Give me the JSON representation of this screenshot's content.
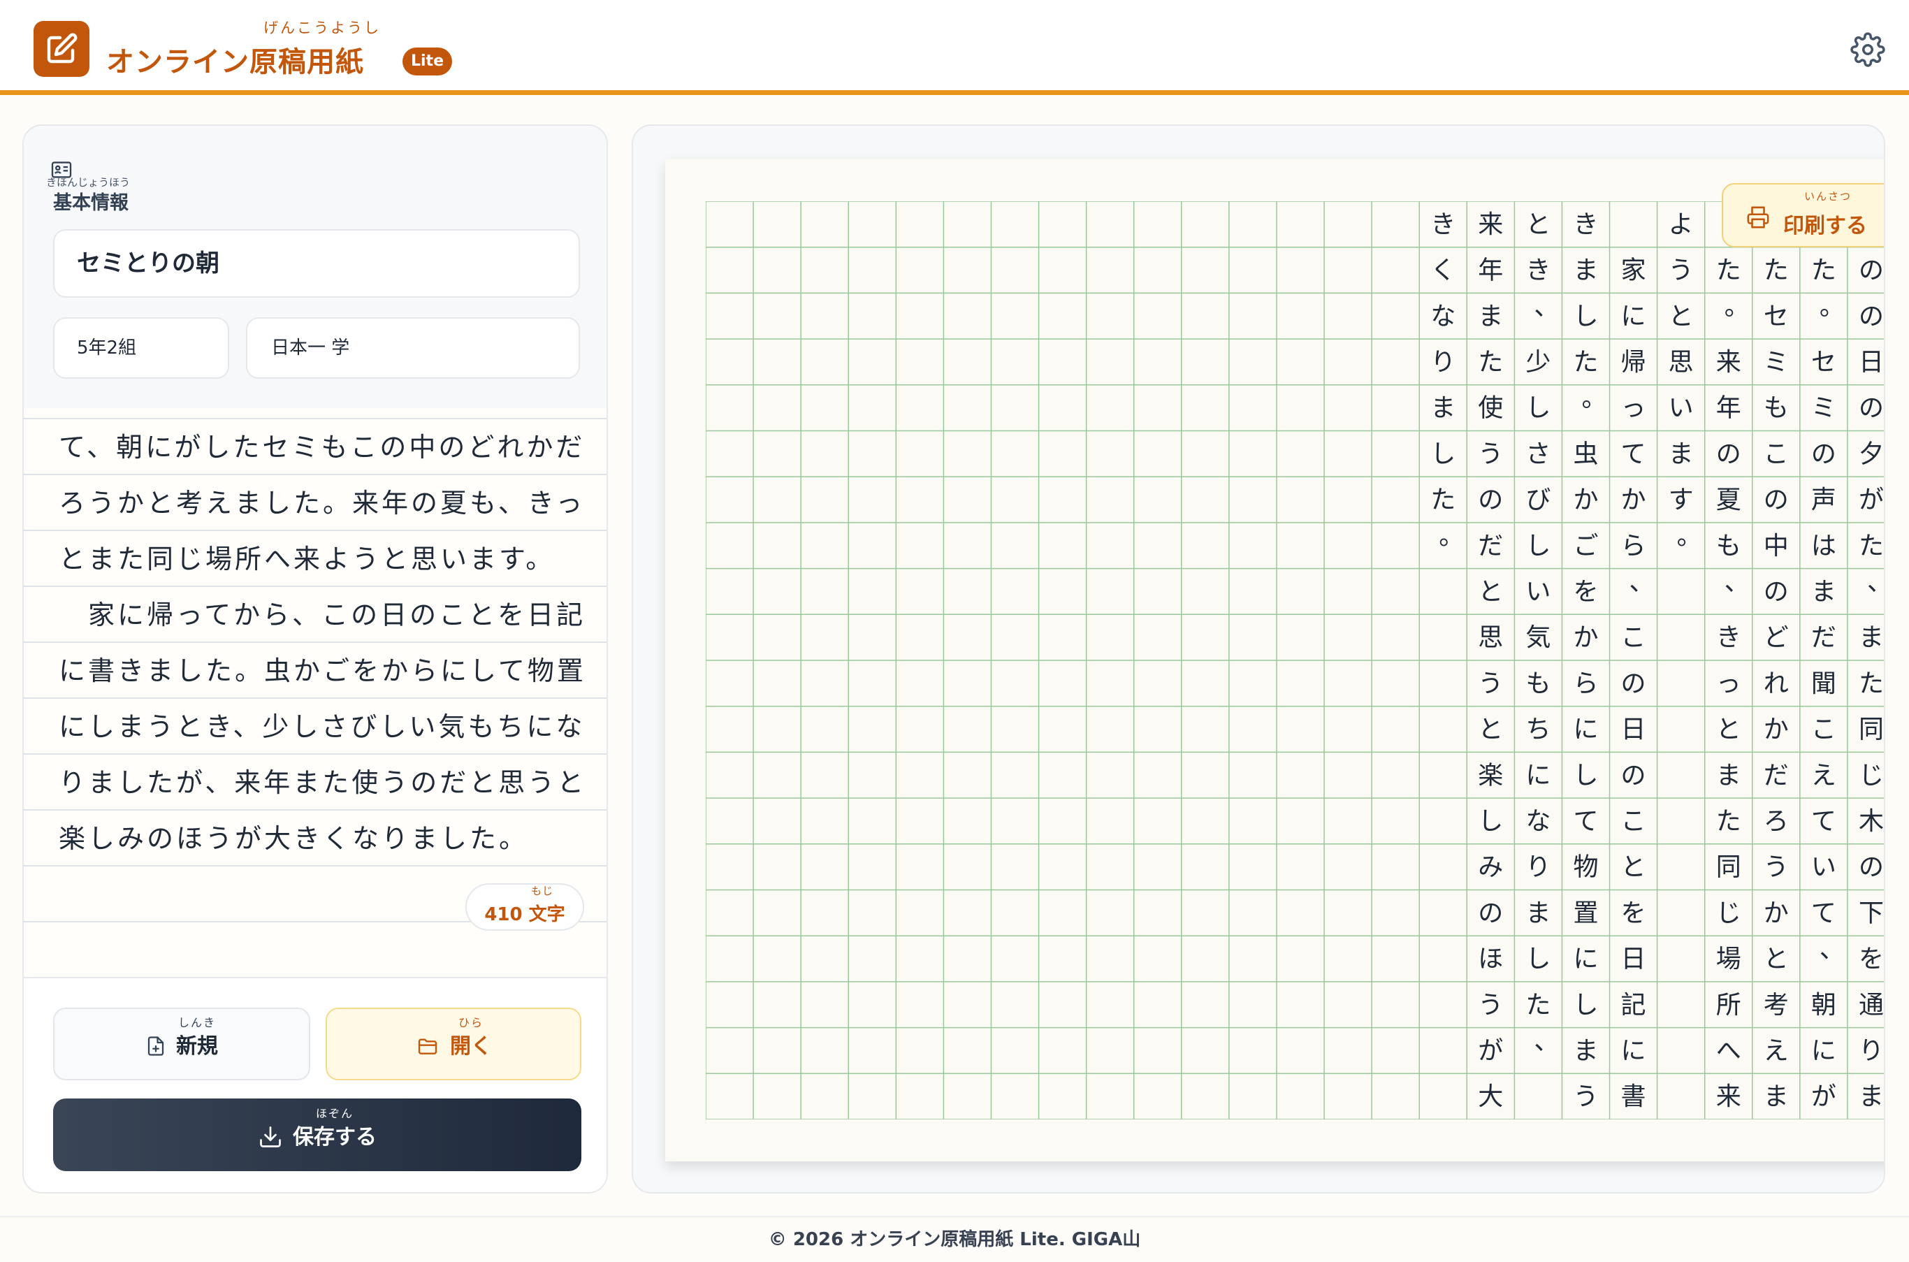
{
  "app": {
    "title": "オンライン原稿用紙",
    "title_ruby": "げんこうようし",
    "badge": "Lite"
  },
  "info": {
    "section_title": "基本情報",
    "section_ruby": "きほんじょうほう",
    "title_value": "セミとりの朝",
    "class_value": "5年2組",
    "name_value": "日本一 学"
  },
  "editor": {
    "lines": [
      "て、朝にがしたセミもこの中のどれかだ",
      "ろうかと考えました。来年の夏も、きっ",
      "とまた同じ場所へ来ようと思います。",
      "　家に帰ってから、この日のことを日記",
      "に書きました。虫かごをからにして物置",
      "にしまうとき、少しさびしい気もちにな",
      "りましたが、来年また使うのだと思うと",
      "楽しみのほうが大きくなりました。"
    ],
    "char_count": "410",
    "char_unit": "文字",
    "char_unit_ruby": "もじ"
  },
  "buttons": {
    "new_label": "新規",
    "new_ruby": "しんき",
    "open_label": "開く",
    "open_ruby": "ひら",
    "save_label": "保存する",
    "save_ruby": "ほぞん"
  },
  "print": {
    "label": "印刷する",
    "ruby": "いんさつ"
  },
  "manuscript": {
    "columns": [
      "そのの日の夕がた、また同じ木の下を通りま",
      "した。セミの声はまだ聞こえていて、朝にが",
      "したセミもこの中のどれかだろうかと考えま",
      "した。来年の夏も、きっとまた同じ場所へ来",
      "ようと思います。",
      "　家に帰ってから、この日のことを日記に書",
      "きました。虫かごをからにして物置にしまう",
      "とき、少しさびしい気もちになりました、",
      "来年また使うのだと思うと楽しみのほうが大",
      "きくなりました。"
    ]
  },
  "footer": {
    "text": "© 2026 オンライン原稿用紙 Lite. GIGA山"
  },
  "colors": {
    "accent": "#c2570c",
    "header_rule": "#e8961a",
    "grid_line": "#9bc89a",
    "save_button": "#1e293b"
  }
}
